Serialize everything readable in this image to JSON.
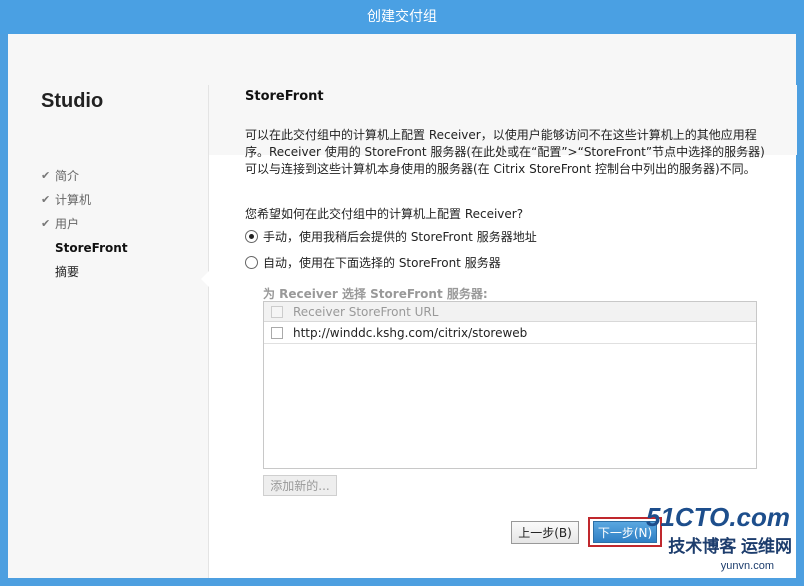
{
  "window": {
    "title": "创建交付组"
  },
  "sidebar": {
    "studio_title": "Studio",
    "steps": [
      {
        "label": "简介",
        "state": "done"
      },
      {
        "label": "计算机",
        "state": "done"
      },
      {
        "label": "用户",
        "state": "done"
      },
      {
        "label": "StoreFront",
        "state": "current"
      },
      {
        "label": "摘要",
        "state": "pending"
      }
    ]
  },
  "main": {
    "section_title": "StoreFront",
    "description": "可以在此交付组中的计算机上配置 Receiver，以使用户能够访问不在这些计算机上的其他应用程序。Receiver 使用的 StoreFront 服务器(在此处或在“配置”>“StoreFront”节点中选择的服务器)可以与连接到这些计算机本身使用的服务器(在 Citrix StoreFront 控制台中列出的服务器)不同。",
    "question": "您希望如何在此交付组中的计算机上配置 Receiver?",
    "options": [
      {
        "label": "手动，使用我稍后会提供的 StoreFront 服务器地址",
        "checked": true
      },
      {
        "label": "自动，使用在下面选择的 StoreFront 服务器",
        "checked": false
      }
    ],
    "server_list_heading": "为 Receiver 选择 StoreFront 服务器:",
    "server_list_column": "Receiver StoreFront URL",
    "servers": [
      {
        "url": "http://winddc.kshg.com/citrix/storeweb"
      }
    ],
    "add_new_label": "添加新的..."
  },
  "footer": {
    "back_label": "上一步(B)",
    "next_label": "下一步(N)"
  },
  "watermark": {
    "line1": "51CTO.com",
    "line2": "技术博客 运维网",
    "line3": "yunvn.com"
  },
  "colors": {
    "titlebar": "#4aa0e3",
    "primary_button": "#2f7fc4",
    "highlight_border": "#c0282d"
  }
}
